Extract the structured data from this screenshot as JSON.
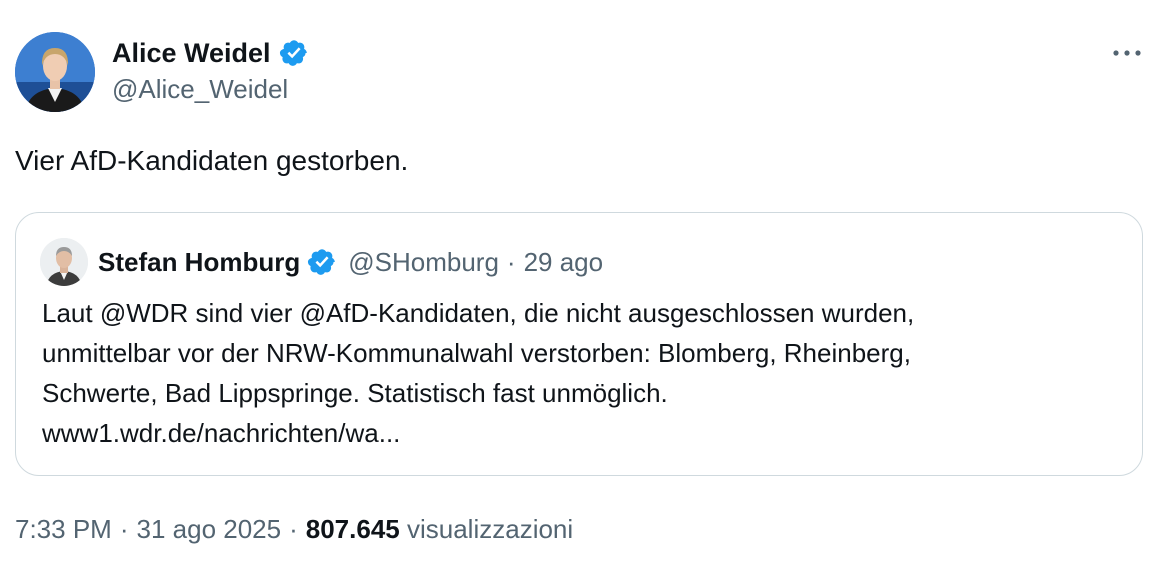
{
  "author": {
    "name": "Alice Weidel",
    "handle": "@Alice_Weidel",
    "verified": true
  },
  "tweet": {
    "text": "Vier AfD-Kandidaten gestorben."
  },
  "quoted": {
    "name": "Stefan Homburg",
    "handle": "@SHomburg",
    "separator": "·",
    "time": "29 ago",
    "verified": true,
    "lines": [
      "Laut @WDR sind vier @AfD-Kandidaten, die nicht ausgeschlossen wurden,",
      "unmittelbar vor der NRW-Kommunalwahl verstorben: Blomberg, Rheinberg,",
      "Schwerte, Bad Lippspringe. Statistisch fast unmöglich.",
      "www1.wdr.de/nachrichten/wa..."
    ]
  },
  "footer": {
    "time": "7:33 PM",
    "separator": "·",
    "date": "31 ago 2025",
    "views_count": "807.645",
    "views_label": "visualizzazioni"
  },
  "colors": {
    "text_primary": "#0f1419",
    "text_secondary": "#536471",
    "verified_blue": "#1d9bf0",
    "border": "#cfd9de"
  },
  "icons": {
    "verified": "verified-badge-icon",
    "more": "more-dots-icon"
  }
}
